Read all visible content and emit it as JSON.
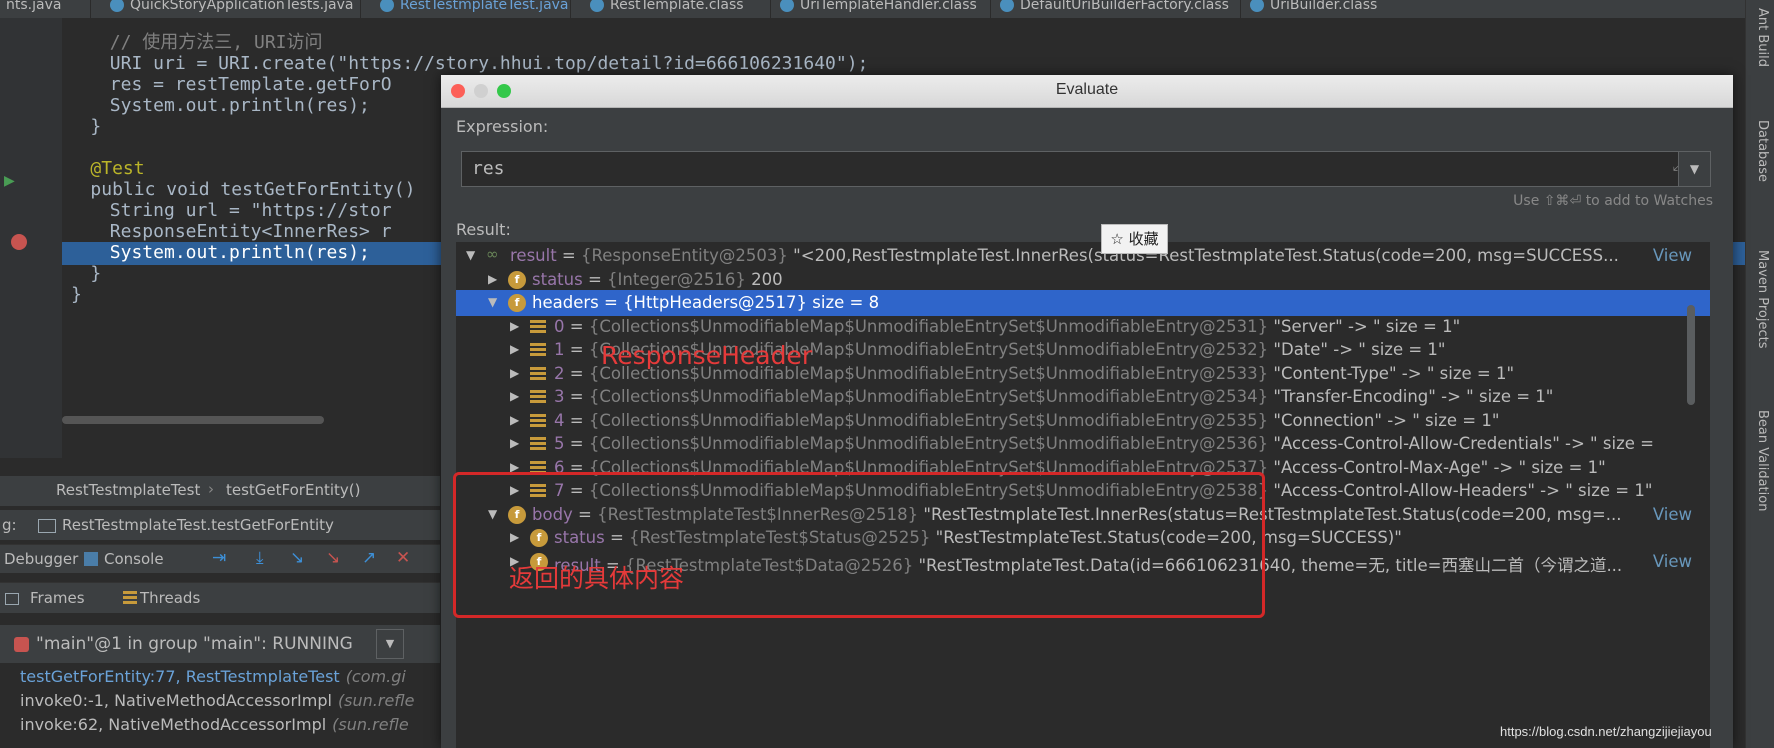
{
  "tabs": [
    "nts.java",
    "QuickStoryApplicationTests.java",
    "RestTestmplateTest.java",
    "RestTemplate.class",
    "UriTemplateHandler.class",
    "DefaultUriBuilderFactory.class",
    "UriBuilder.class"
  ],
  "right_tools": [
    "Ant Build",
    "Database",
    "Maven Projects",
    "Bean Validation"
  ],
  "editor": {
    "lines": [
      {
        "text": "// 使用方法三, URI访问",
        "indent": 4,
        "kind": "comment"
      },
      {
        "text": "URI uri = URI.create(\"https://story.hhui.top/detail?id=666106231640\");",
        "indent": 4,
        "kind": "code"
      },
      {
        "text": "res = restTemplate.getForO",
        "indent": 4,
        "kind": "code"
      },
      {
        "text": "System.out.println(res);",
        "indent": 4,
        "kind": "code"
      },
      {
        "text": "}",
        "indent": 2,
        "kind": "code"
      },
      {
        "text": "",
        "indent": 0,
        "kind": "blank"
      },
      {
        "text": "@Test",
        "indent": 2,
        "kind": "annotation"
      },
      {
        "text": "public void testGetForEntity()",
        "indent": 2,
        "kind": "code"
      },
      {
        "text": "String url = \"https://stor",
        "indent": 4,
        "kind": "code"
      },
      {
        "text": "ResponseEntity<InnerRes> r",
        "indent": 4,
        "kind": "code"
      },
      {
        "text": "System.out.println(res);",
        "indent": 4,
        "kind": "highlight"
      },
      {
        "text": "}",
        "indent": 2,
        "kind": "code"
      },
      {
        "text": "}",
        "indent": 0,
        "kind": "code"
      }
    ]
  },
  "breadcrumb": {
    "class": "RestTestmplateTest",
    "method": "testGetForEntity()"
  },
  "debug": {
    "label": "g:",
    "config": "RestTestmplateTest.testGetForEntity",
    "tab_debugger": "Debugger",
    "tab_console": "Console",
    "frames": "Frames",
    "threads": "Threads",
    "thread": "\"main\"@1 in group \"main\": RUNNING",
    "stack": [
      {
        "name": "testGetForEntity:77, RestTestmplateTest",
        "pkg": "(com.gi"
      },
      {
        "name": "invoke0:-1, NativeMethodAccessorImpl",
        "pkg": "(sun.refle"
      },
      {
        "name": "invoke:62, NativeMethodAccessorImpl",
        "pkg": "(sun.refle"
      }
    ]
  },
  "dialog": {
    "title": "Evaluate",
    "expression_label": "Expression:",
    "expression": "res",
    "hint": "Use ⇧⌘⏎ to add to Watches",
    "result_label": "Result:",
    "rows": [
      {
        "indent": 0,
        "arrow": "▼",
        "icon": "result",
        "name": "result",
        "type": "{ResponseEntity@2503}",
        "value": "\"<200,RestTestmplateTest.InnerRes(status=RestTestmplateTest.Status(code=200, msg=SUCCESS...",
        "view": "View"
      },
      {
        "indent": 1,
        "arrow": "▶",
        "icon": "f",
        "name": "status",
        "type": "{Integer@2516}",
        "value": "200",
        "view": ""
      },
      {
        "indent": 1,
        "arrow": "▼",
        "icon": "f",
        "name": "headers",
        "type": "{HttpHeaders@2517}",
        "value": " size = 8",
        "view": "",
        "selected": true
      },
      {
        "indent": 2,
        "arrow": "▶",
        "icon": "list",
        "name": "0",
        "type": "{Collections$UnmodifiableMap$UnmodifiableEntrySet$UnmodifiableEntry@2531}",
        "value": "\"Server\" -> \" size = 1\"",
        "view": ""
      },
      {
        "indent": 2,
        "arrow": "▶",
        "icon": "list",
        "name": "1",
        "type": "{Collections$UnmodifiableMap$UnmodifiableEntrySet$UnmodifiableEntry@2532}",
        "value": "\"Date\" -> \" size = 1\"",
        "view": ""
      },
      {
        "indent": 2,
        "arrow": "▶",
        "icon": "list",
        "name": "2",
        "type": "{Collections$UnmodifiableMap$UnmodifiableEntrySet$UnmodifiableEntry@2533}",
        "value": "\"Content-Type\" -> \" size = 1\"",
        "view": ""
      },
      {
        "indent": 2,
        "arrow": "▶",
        "icon": "list",
        "name": "3",
        "type": "{Collections$UnmodifiableMap$UnmodifiableEntrySet$UnmodifiableEntry@2534}",
        "value": "\"Transfer-Encoding\" -> \" size = 1\"",
        "view": ""
      },
      {
        "indent": 2,
        "arrow": "▶",
        "icon": "list",
        "name": "4",
        "type": "{Collections$UnmodifiableMap$UnmodifiableEntrySet$UnmodifiableEntry@2535}",
        "value": "\"Connection\" -> \" size = 1\"",
        "view": ""
      },
      {
        "indent": 2,
        "arrow": "▶",
        "icon": "list",
        "name": "5",
        "type": "{Collections$UnmodifiableMap$UnmodifiableEntrySet$UnmodifiableEntry@2536}",
        "value": "\"Access-Control-Allow-Credentials\" -> \" size =",
        "view": ""
      },
      {
        "indent": 2,
        "arrow": "▶",
        "icon": "list",
        "name": "6",
        "type": "{Collections$UnmodifiableMap$UnmodifiableEntrySet$UnmodifiableEntry@2537}",
        "value": "\"Access-Control-Max-Age\" -> \" size = 1\"",
        "view": ""
      },
      {
        "indent": 2,
        "arrow": "▶",
        "icon": "list",
        "name": "7",
        "type": "{Collections$UnmodifiableMap$UnmodifiableEntrySet$UnmodifiableEntry@2538}",
        "value": "\"Access-Control-Allow-Headers\" -> \" size = 1\"",
        "view": ""
      },
      {
        "indent": 1,
        "arrow": "▼",
        "icon": "f",
        "name": "body",
        "type": "{RestTestmplateTest$InnerRes@2518}",
        "value": "\"RestTestmplateTest.InnerRes(status=RestTestmplateTest.Status(code=200, msg=...",
        "view": "View"
      },
      {
        "indent": 2,
        "arrow": "▶",
        "icon": "f",
        "name": "status",
        "type": "{RestTestmplateTest$Status@2525}",
        "value": "\"RestTestmplateTest.Status(code=200, msg=SUCCESS)\"",
        "view": ""
      },
      {
        "indent": 2,
        "arrow": "▶",
        "icon": "f",
        "name": "result",
        "type": "{RestTestmplateTest$Data@2526}",
        "value": "\"RestTestmplateTest.Data(id=666106231640, theme=无, title=西塞山二首（今谓之道...",
        "view": "View"
      }
    ]
  },
  "popup": "☆ 收藏",
  "annotations": {
    "header": "ResponseHeader",
    "body": "返回的具体内容"
  },
  "watermark": "https://blog.csdn.net/zhangzijiejiayou",
  "colors": {
    "selection": "#2f65ca",
    "annotation": "#e53a3a",
    "field_icon": "#c79a3b"
  }
}
